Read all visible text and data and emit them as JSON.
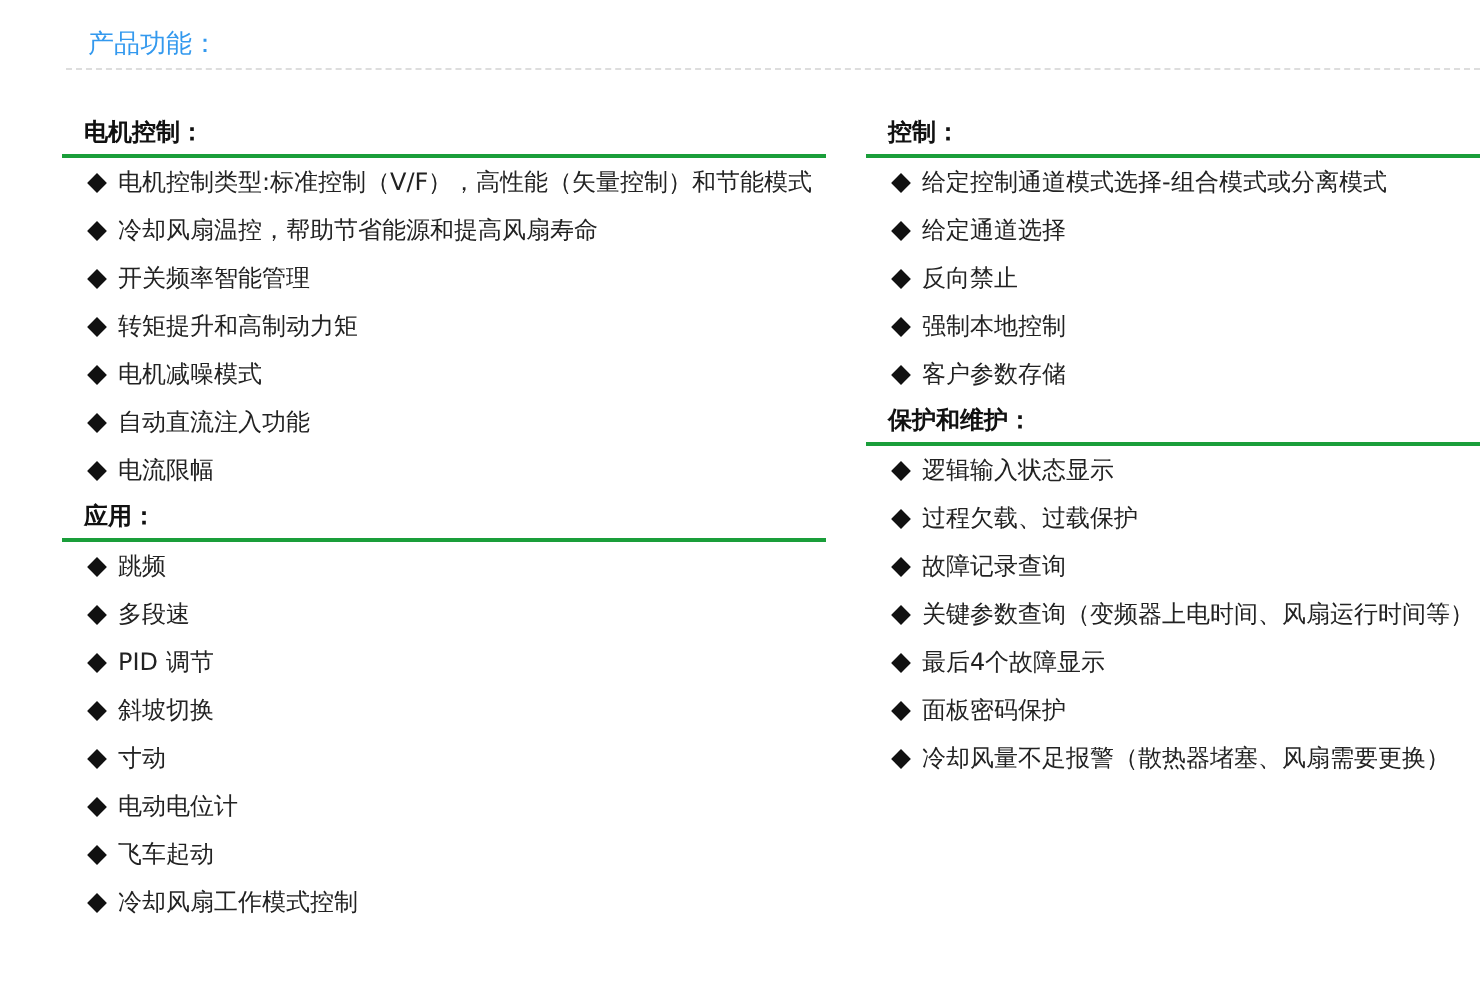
{
  "title": "产品功能：",
  "columns": [
    {
      "sections": [
        {
          "heading": "电机控制：",
          "items": [
            "电机控制类型:标准控制（V/F），高性能（矢量控制）和节能模式",
            "冷却风扇温控，帮助节省能源和提高风扇寿命",
            "开关频率智能管理",
            "转矩提升和高制动力矩",
            "电机减噪模式",
            "自动直流注入功能",
            "电流限幅"
          ]
        },
        {
          "heading": "应用：",
          "items": [
            "跳频",
            "多段速",
            "PID 调节",
            "斜坡切换",
            "寸动",
            "电动电位计",
            "飞车起动",
            "冷却风扇工作模式控制"
          ]
        }
      ]
    },
    {
      "sections": [
        {
          "heading": "控制：",
          "items": [
            "给定控制通道模式选择-组合模式或分离模式",
            "给定通道选择",
            "反向禁止",
            "强制本地控制",
            "客户参数存储"
          ]
        },
        {
          "heading": "保护和维护：",
          "items": [
            "逻辑输入状态显示",
            "过程欠载、过载保护",
            "故障记录查询",
            "关键参数查询（变频器上电时间、风扇运行时间等）",
            "最后4个故障显示",
            "面板密码保护",
            "冷却风量不足报警（散热器堵塞、风扇需要更换）"
          ]
        }
      ]
    }
  ]
}
